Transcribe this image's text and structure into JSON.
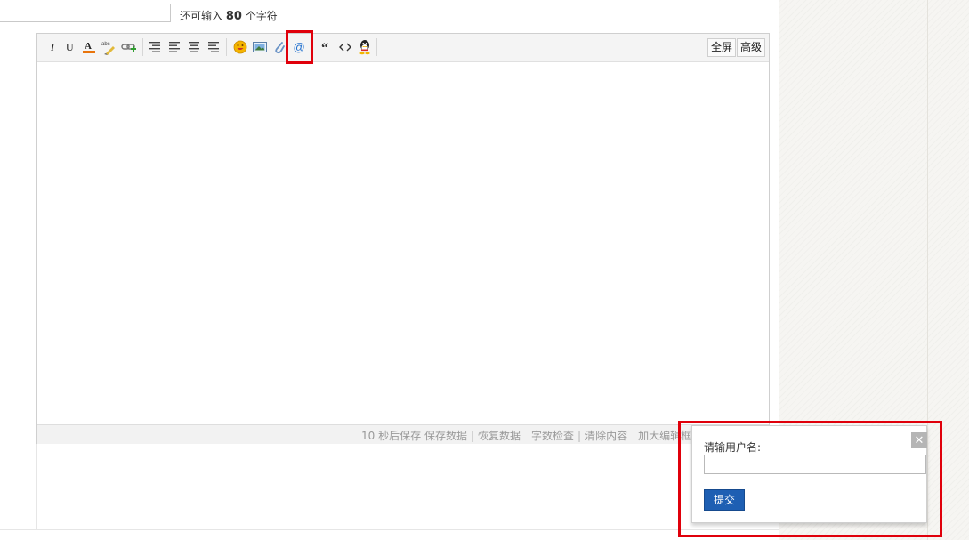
{
  "title_row": {
    "char_count_prefix": "还可输入",
    "char_count_value": "80",
    "char_count_suffix": "个字符"
  },
  "toolbar": {
    "buttons": [
      {
        "icon": "italic-icon",
        "glyph": "I"
      },
      {
        "icon": "underline-icon",
        "glyph": "U"
      },
      {
        "icon": "font-color-icon",
        "glyph": "A"
      },
      {
        "icon": "highlight-icon",
        "glyph": "abc"
      },
      {
        "icon": "link-icon",
        "glyph": "∞"
      },
      {
        "icon": "align-left-icon",
        "glyph": "≡"
      },
      {
        "icon": "align-justify-icon",
        "glyph": "≡"
      },
      {
        "icon": "align-center-icon",
        "glyph": "≡"
      },
      {
        "icon": "align-right-icon",
        "glyph": "≡"
      },
      {
        "icon": "emoticon-icon",
        "glyph": "☻"
      },
      {
        "icon": "image-icon",
        "glyph": "▣"
      },
      {
        "icon": "attachment-icon",
        "glyph": "🔗"
      },
      {
        "icon": "at-mention-icon",
        "glyph": "@"
      },
      {
        "icon": "quote-icon",
        "glyph": "“"
      },
      {
        "icon": "code-icon",
        "glyph": "<>"
      },
      {
        "icon": "qq-icon",
        "glyph": "🐧"
      }
    ],
    "fullscreen_label": "全屏",
    "advanced_label": "高级"
  },
  "statusbar": {
    "autosave_countdown": "10",
    "autosave_text": "秒后保存",
    "save_data": "保存数据",
    "restore_data": "恢复数据",
    "word_check": "字数检查",
    "clear_content": "清除内容",
    "enlarge_editor": "加大编辑框"
  },
  "popup": {
    "label": "请输用户名:",
    "input_value": "",
    "submit_label": "提交",
    "close_glyph": "✕"
  },
  "colors": {
    "highlight_border": "#e0000b",
    "submit_button": "#1e5fb3",
    "at_icon": "#1f6fcf"
  }
}
